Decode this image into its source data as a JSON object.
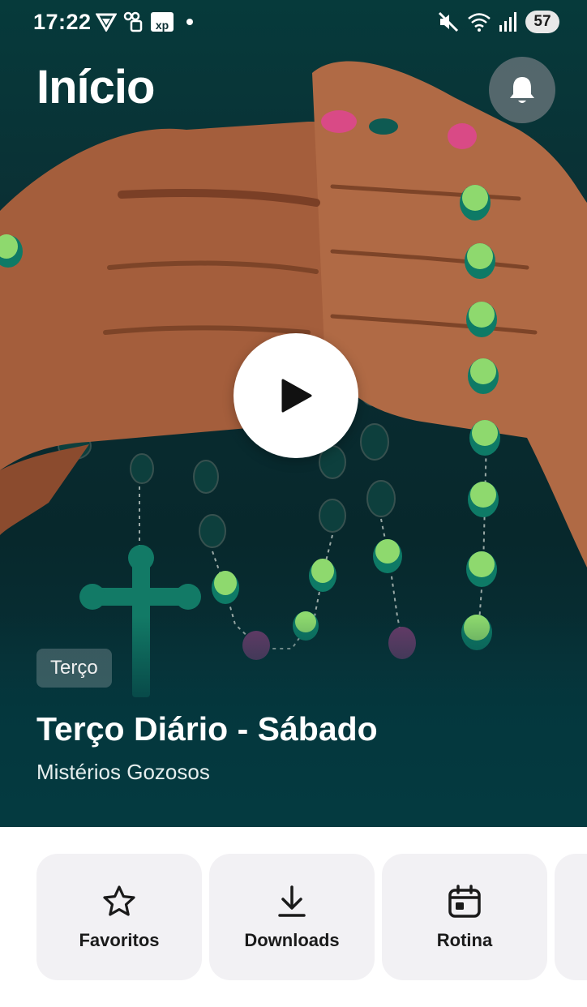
{
  "status_bar": {
    "time": "17:22",
    "battery": "57",
    "icons_left": [
      "vpn-icon",
      "sim-icon",
      "xp-app-icon",
      "dot-icon"
    ],
    "icons_right": [
      "mute-icon",
      "wifi-icon",
      "signal-icon"
    ],
    "xp_label": "xp"
  },
  "header": {
    "title": "Início",
    "bell": "bell-icon"
  },
  "hero": {
    "tag": "Terço",
    "title": "Terço Diário - Sábado",
    "subtitle": "Mistérios Gozosos",
    "play": "play-icon"
  },
  "shortcuts": [
    {
      "label": "Favoritos",
      "icon": "star-icon"
    },
    {
      "label": "Downloads",
      "icon": "download-icon"
    },
    {
      "label": "Rotina",
      "icon": "calendar-icon"
    }
  ],
  "colors": {
    "hero_bg": "#0b2e33",
    "skin": "#a5603e",
    "bead_green": "#7cc96a",
    "bead_teal": "#0e5a52",
    "bead_pink": "#d94a86",
    "bead_purple": "#6b3a6a",
    "card_bg": "#f2f1f4"
  }
}
